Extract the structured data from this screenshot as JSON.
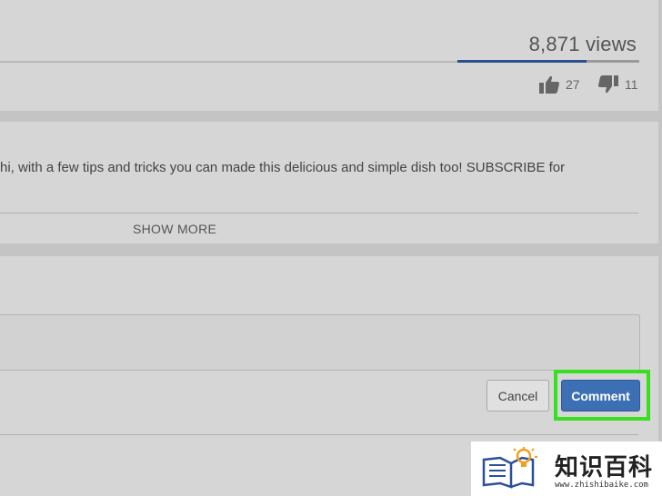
{
  "video": {
    "views": "8,871 views",
    "likes": "27",
    "dislikes": "11",
    "like_ratio": 0.71
  },
  "description": {
    "text": "hi, with a few tips and tricks you can made this delicious and simple dish too! SUBSCRIBE for",
    "show_more_label": "SHOW MORE"
  },
  "comment": {
    "cancel_label": "Cancel",
    "submit_label": "Comment",
    "highlight_color": "#35e01d"
  },
  "watermark": {
    "title": "知识百科",
    "url": "www.zhishibaike.com"
  }
}
